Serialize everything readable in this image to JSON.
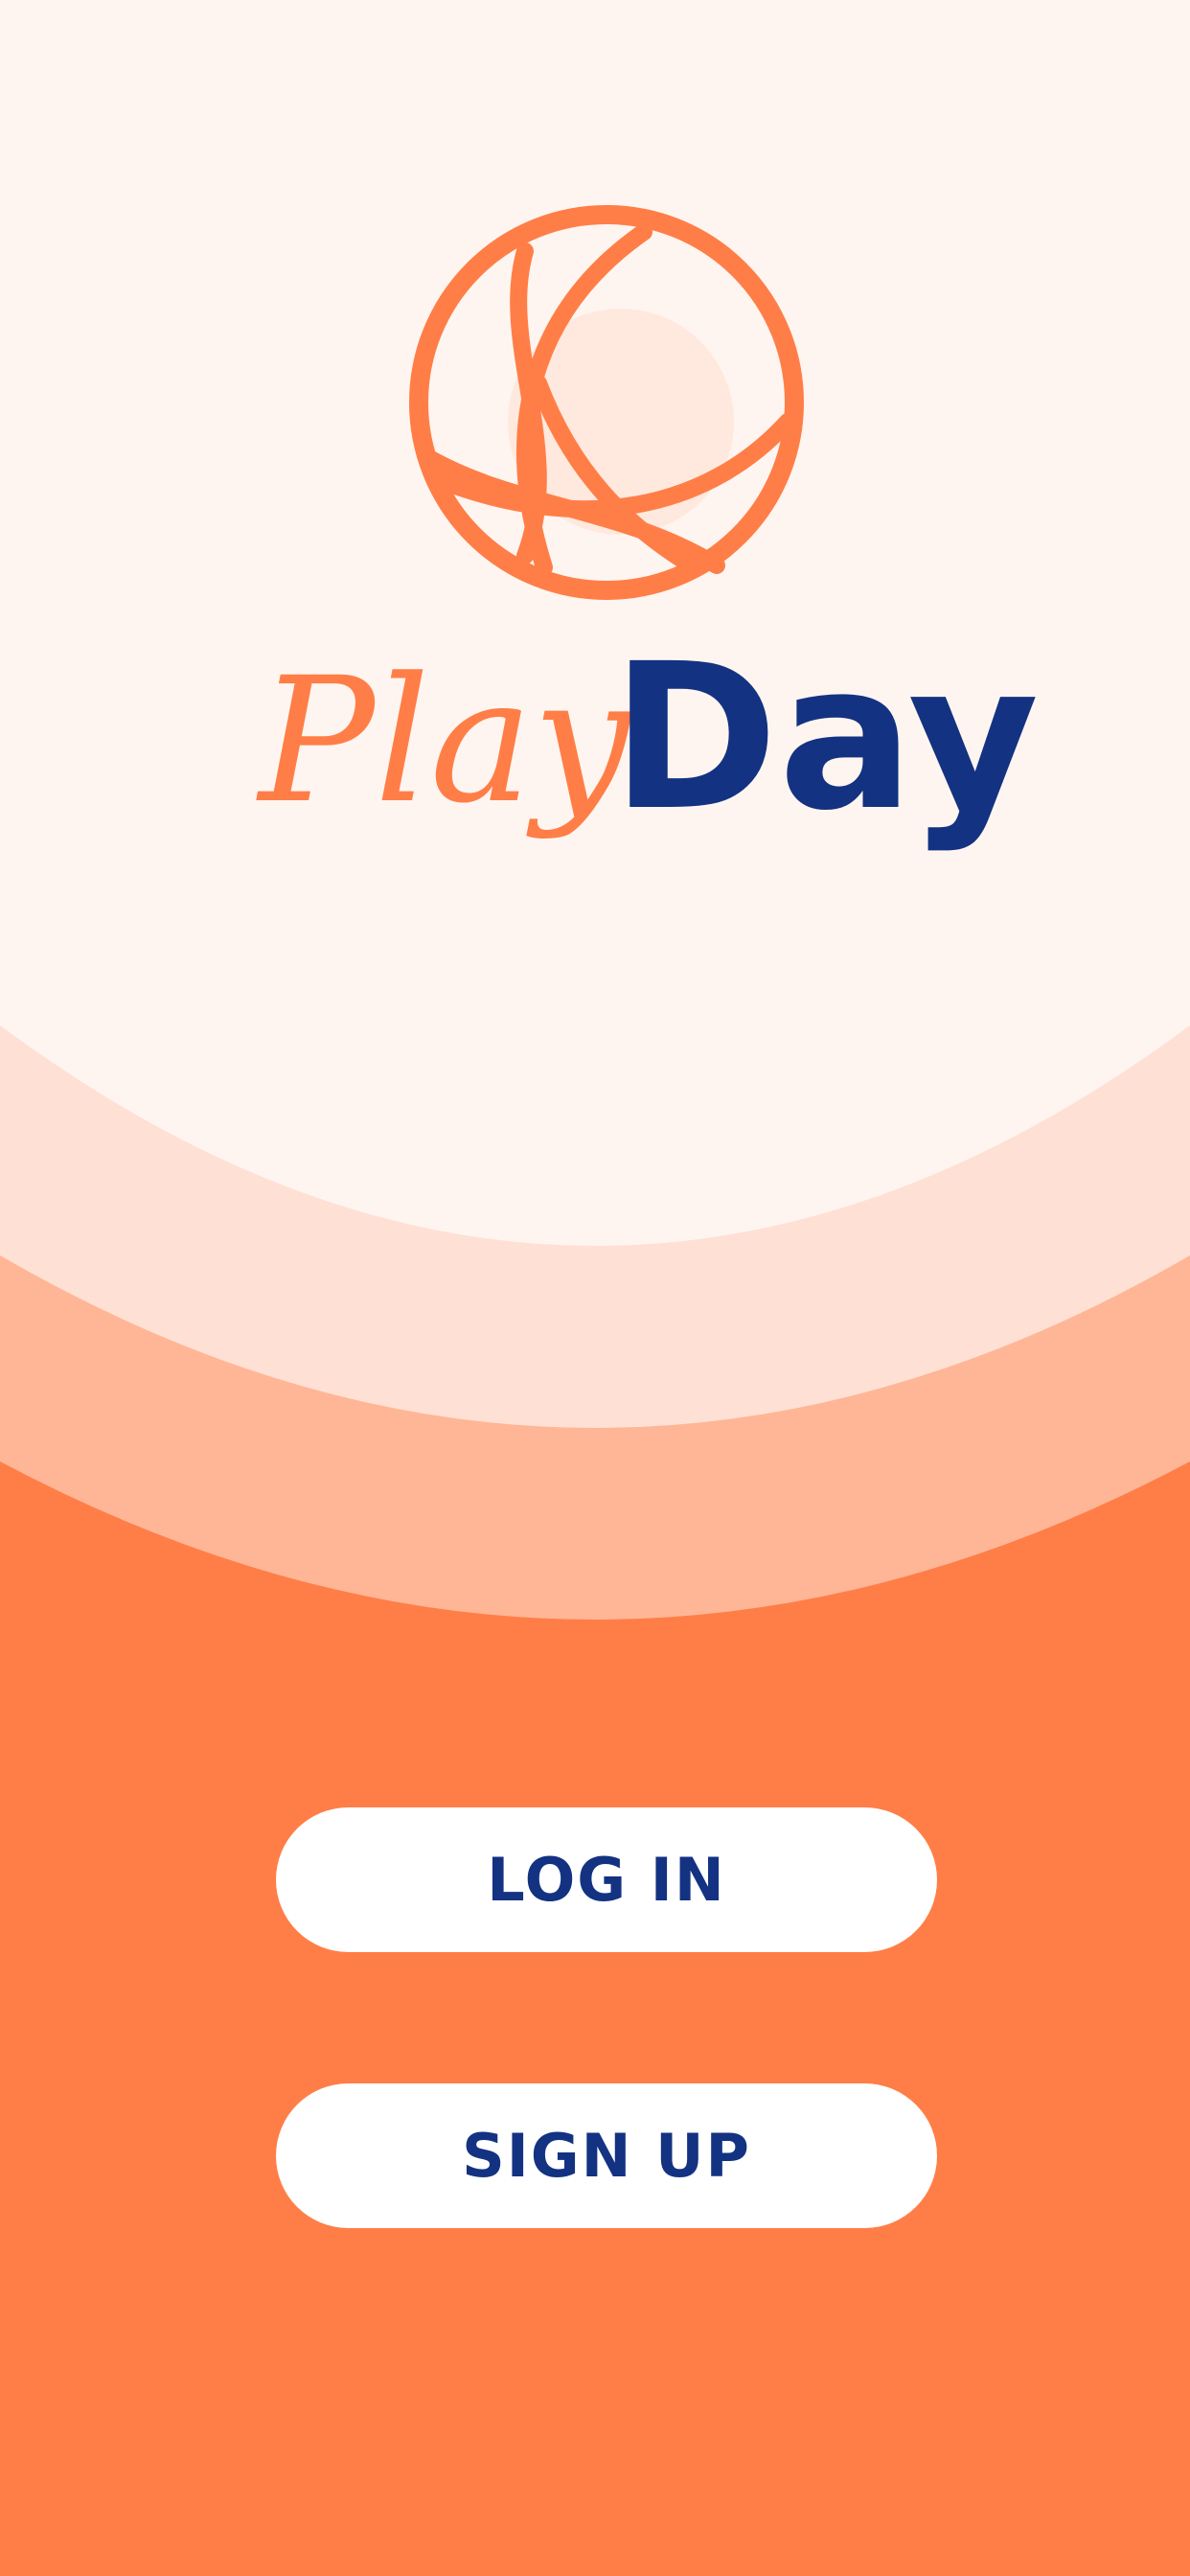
{
  "app": {
    "name_play": "Play",
    "name_day": "Day"
  },
  "buttons": {
    "login_label": "LOG IN",
    "signup_label": "SIGN UP"
  },
  "colors": {
    "brand_orange": "#FF7E47",
    "brand_navy": "#133282",
    "band_1": "#FFF5F0",
    "band_2": "#FFE0D4",
    "band_3": "#FFB696",
    "logo_fill": "#FFE9DE",
    "button_bg": "#FFFFFF"
  },
  "icons": {
    "logo_mark": "basketball-icon"
  }
}
